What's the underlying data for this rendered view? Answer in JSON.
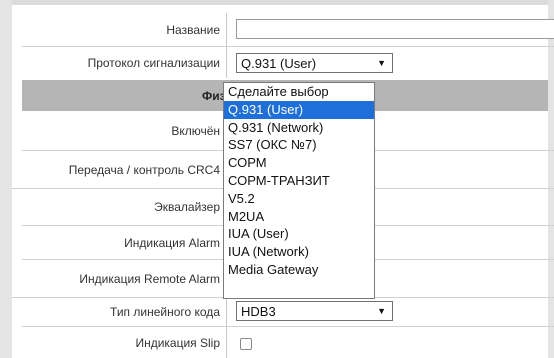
{
  "form": {
    "name_label": "Название",
    "name_value": "",
    "protocol_label": "Протокол сигнализации",
    "protocol_value": "Q.931 (User)",
    "section_title": "Физ",
    "enabled_label": "Включён",
    "crc4_label": "Передача / контроль CRC4",
    "equalizer_label": "Эквалайзер",
    "alarm_label": "Индикация Alarm",
    "remote_alarm_label": "Индикация Remote Alarm",
    "line_code_label": "Тип линейного кода",
    "line_code_value": "HDB3",
    "slip_label": "Индикация Slip",
    "slip_checked": false
  },
  "dropdown": {
    "options": [
      "Сделайте выбор",
      "Q.931 (User)",
      "Q.931 (Network)",
      "SS7 (ОКС №7)",
      "СОРМ",
      "СОРМ-ТРАНЗИТ",
      "V5.2",
      "M2UA",
      "IUA (User)",
      "IUA (Network)",
      "Media Gateway"
    ],
    "selected_index": 1
  },
  "colors": {
    "selection": "#1e6fd9",
    "section_header": "#b5b5b5"
  }
}
